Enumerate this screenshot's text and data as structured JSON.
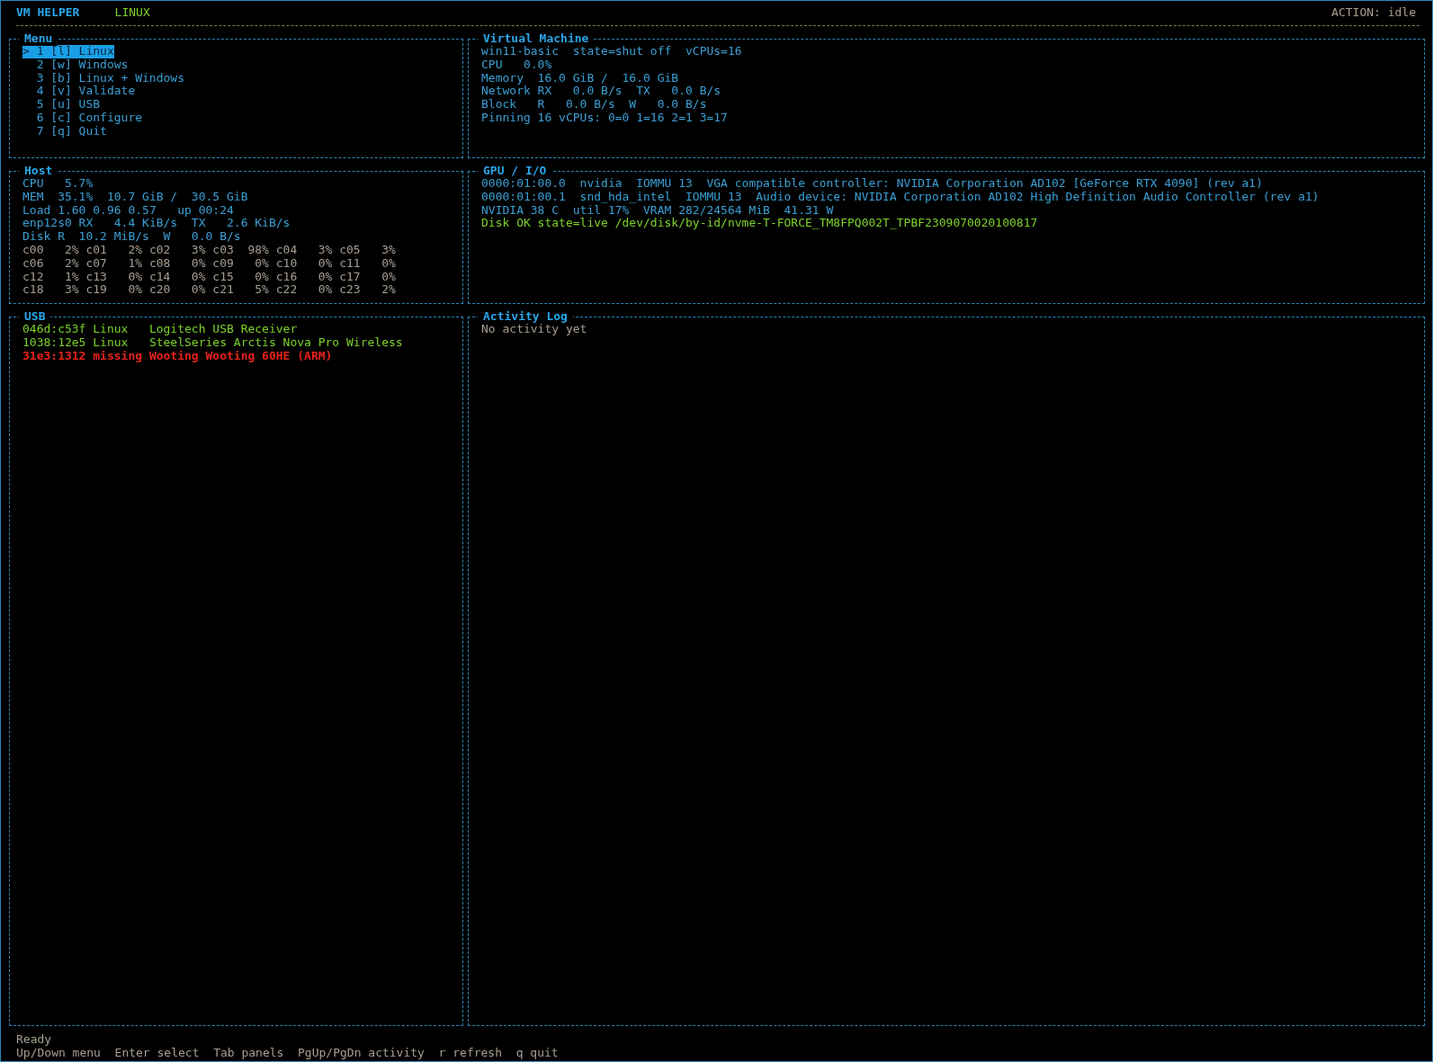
{
  "header": {
    "title": "VM HELPER",
    "mode": "LINUX",
    "action": "ACTION: idle"
  },
  "panels": [
    {
      "title": "Menu",
      "items": [
        {
          "text": "> 1 [l] Linux",
          "selected": true
        },
        {
          "text": "2 [w] Windows",
          "selected": false
        },
        {
          "text": "3 [b] Linux + Windows",
          "selected": false
        },
        {
          "text": "4 [v] Validate",
          "selected": false
        },
        {
          "text": "5 [u] USB",
          "selected": false
        },
        {
          "text": "6 [c] Configure",
          "selected": false
        },
        {
          "text": "7 [q] Quit",
          "selected": false
        }
      ]
    },
    {
      "title": "Virtual Machine",
      "lines": [
        {
          "text": "win11-basic  state=shut off  vCPUs=16",
          "kind": "info"
        },
        {
          "text": "CPU   0.0%",
          "kind": "info"
        },
        {
          "text": "Memory  16.0 GiB /  16.0 GiB",
          "kind": "info"
        },
        {
          "text": "Network RX   0.0 B/s  TX   0.0 B/s",
          "kind": "info"
        },
        {
          "text": "Block   R   0.0 B/s  W   0.0 B/s",
          "kind": "info"
        },
        {
          "text": "Pinning 16 vCPUs: 0=0 1=16 2=1 3=17",
          "kind": "info"
        }
      ]
    },
    {
      "title": "Host",
      "lines": [
        {
          "text": "CPU   5.7%",
          "kind": "info"
        },
        {
          "text": "MEM  35.1%  10.7 GiB /  30.5 GiB",
          "kind": "info"
        },
        {
          "text": "Load 1.60 0.96 0.57   up 00:24",
          "kind": "info"
        },
        {
          "text": "enp12s0 RX   4.4 KiB/s  TX   2.6 KiB/s",
          "kind": "info"
        },
        {
          "text": "Disk R  10.2 MiB/s  W   0.0 B/s",
          "kind": "info"
        },
        {
          "text": "c00   2% c01   2% c02   3% c03  98% c04   3% c05   3%",
          "kind": "muted"
        },
        {
          "text": "c06   2% c07   1% c08   0% c09   0% c10   0% c11   0%",
          "kind": "muted"
        },
        {
          "text": "c12   1% c13   0% c14   0% c15   0% c16   0% c17   0%",
          "kind": "muted"
        },
        {
          "text": "c18   3% c19   0% c20   0% c21   5% c22   0% c23   2%",
          "kind": "muted"
        }
      ]
    },
    {
      "title": "GPU / I/O",
      "lines": [
        {
          "text": "0000:01:00.0  nvidia  IOMMU 13  VGA compatible controller: NVIDIA Corporation AD102 [GeForce RTX 4090] (rev a1)",
          "kind": "info"
        },
        {
          "text": "0000:01:00.1  snd_hda_intel  IOMMU 13  Audio device: NVIDIA Corporation AD102 High Definition Audio Controller (rev a1)",
          "kind": "info"
        },
        {
          "text": "NVIDIA 38 C  util 17%  VRAM 282/24564 MiB  41.31 W",
          "kind": "info"
        },
        {
          "text": "Disk OK state=live /dev/disk/by-id/nvme-T-FORCE_TM8FPQ002T_TPBF2309070020100817",
          "kind": "ok"
        }
      ]
    },
    {
      "title": "USB",
      "lines": [
        {
          "text": "046d:c53f Linux   Logitech USB Receiver",
          "kind": "ok"
        },
        {
          "text": "1038:12e5 Linux   SteelSeries Arctis Nova Pro Wireless",
          "kind": "ok"
        },
        {
          "text": "31e3:1312 missing Wooting Wooting 60HE (ARM)",
          "kind": "error"
        }
      ]
    },
    {
      "title": "Activity Log",
      "lines": [
        {
          "text": "No activity yet",
          "kind": "muted"
        }
      ]
    }
  ],
  "status": {
    "message": "Ready",
    "hints": [
      "Up/Down menu",
      "Enter select",
      "Tab panels",
      "PgUp/PgDn activity",
      "r refresh",
      "q quit"
    ]
  }
}
